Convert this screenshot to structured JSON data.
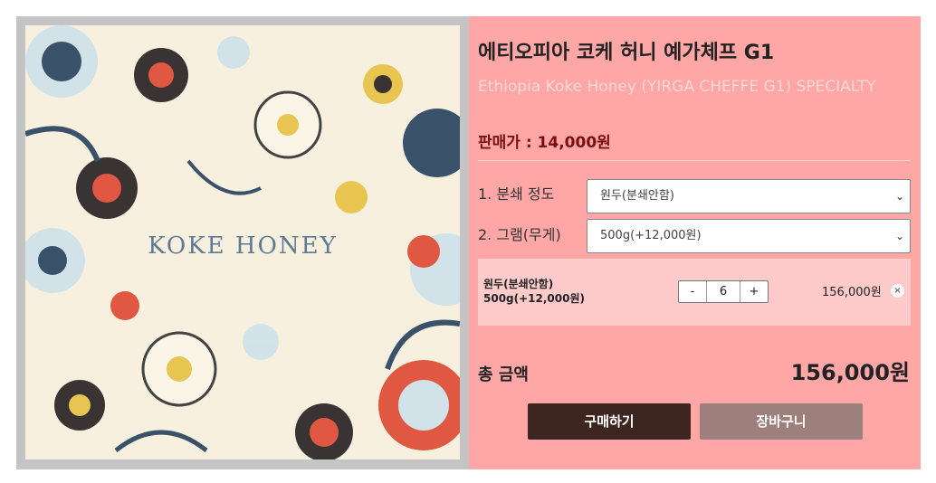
{
  "product": {
    "title": "에티오피아 코케 허니 예가체프 G1",
    "subtitle": "Ethiopia Koke Honey (YIRGA CHEFFE G1) SPECIALTY",
    "price_label": "판매가 : 14,000원",
    "image_text": "KOKE  HONEY"
  },
  "options": [
    {
      "label": "1. 분쇄 정도",
      "value": "원두(분쇄안함)",
      "icon": "chevron-down-icon"
    },
    {
      "label": "2. 그램(무게)",
      "value": "500g(+12,000원)",
      "icon": "chevron-down-icon"
    }
  ],
  "selection": {
    "line1": "원두(분쇄안함)",
    "line2": "500g(+12,000원)",
    "minus": "-",
    "quantity": "6",
    "plus": "+",
    "price": "156,000원",
    "remove": "×"
  },
  "total": {
    "label": "총 금액",
    "value": "156,000원"
  },
  "buttons": {
    "buy": "구매하기",
    "cart": "장바구니"
  },
  "colors": {
    "panel_bg": "#ffa7a7",
    "selected_bg": "#ffcaca",
    "price_color": "#7b0f0f",
    "buy_button": "#3d2520",
    "cart_button": "#9d807b"
  }
}
